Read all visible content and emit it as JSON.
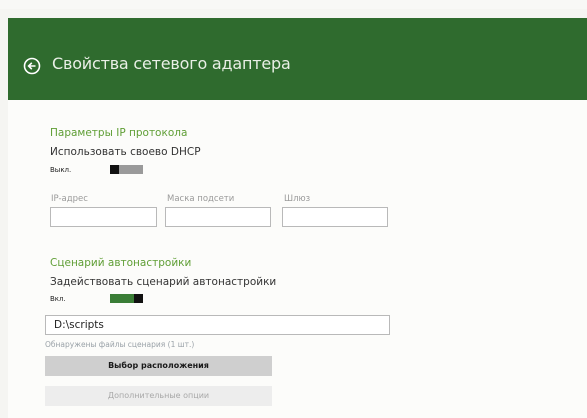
{
  "header": {
    "title": "Свойства сетевого адаптера",
    "accent_color": "#2f6b2e"
  },
  "ip_section": {
    "title": "Параметры IP протокола",
    "dhcp_label": "Использовать своево DHCP",
    "dhcp_state_label": "Выкл.",
    "dhcp_enabled": false,
    "fields": [
      {
        "label": "IP-адрес",
        "value": ""
      },
      {
        "label": "Маска подсети",
        "value": ""
      },
      {
        "label": "Шлюз",
        "value": ""
      }
    ]
  },
  "script_section": {
    "title": "Сценарий автонастройки",
    "use_label": "Задействовать сценарий автонастройки",
    "use_state_label": "Вкл.",
    "use_enabled": true,
    "path_value": "D:\\scripts",
    "found_text": "Обнаружены файлы сценария (1 шт.)",
    "choose_location_label": "Выбор расположения",
    "more_options_label": "Дополнительные опции"
  },
  "colors": {
    "section_title": "#5f9e35",
    "toggle_on": "#3a7d36",
    "toggle_off": "#9a9a9a"
  },
  "icons": {
    "back": "arrow-left-circle"
  }
}
